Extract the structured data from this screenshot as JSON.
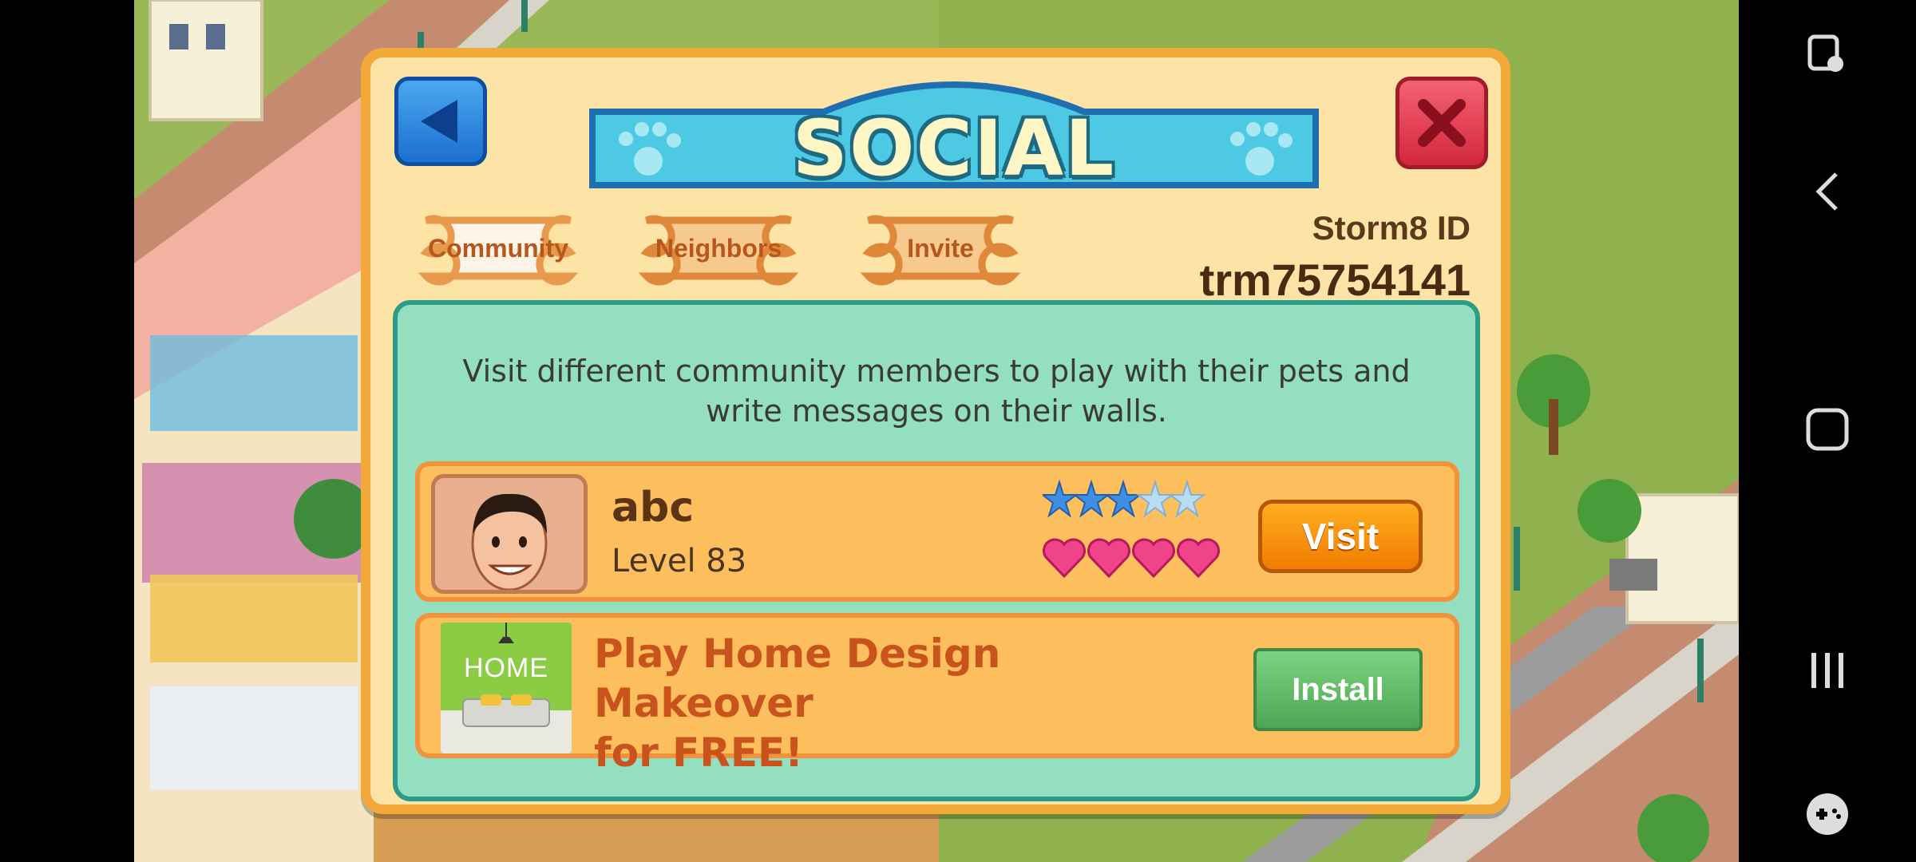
{
  "colors": {
    "dialog_bg": "#fde3a6",
    "dialog_border": "#f2a93a",
    "content_bg": "#93dfc0",
    "title_banner": "#4ec9e3",
    "visit_button": "#f58a0b",
    "install_button": "#5cb85f",
    "close_button": "#e23a4d",
    "back_button": "#2c86e0"
  },
  "dialog": {
    "title": "SOCIAL",
    "back_icon": "triangle-left-icon",
    "close_icon": "x-icon",
    "tabs": [
      {
        "label": "Community"
      },
      {
        "label": "Neighbors"
      },
      {
        "label": "Invite"
      }
    ],
    "storm8_label": "Storm8 ID",
    "storm8_id": "trm75754141",
    "description_line1": "Visit different community members to play with their pets and",
    "description_line2": "write messages on their walls.",
    "friend": {
      "name": "abc",
      "level": "Level 83",
      "stars_filled": 3,
      "stars_total": 5,
      "hearts": 4,
      "visit_label": "Visit"
    },
    "ad": {
      "icon_text": "HOME",
      "text_line1": "Play Home Design Makeover",
      "text_line2": "for FREE!",
      "install_label": "Install"
    }
  },
  "navbar": {
    "icons": [
      "screen-assist-icon",
      "back-chevron-icon",
      "home-square-icon",
      "recents-icon",
      "game-tools-icon"
    ]
  }
}
